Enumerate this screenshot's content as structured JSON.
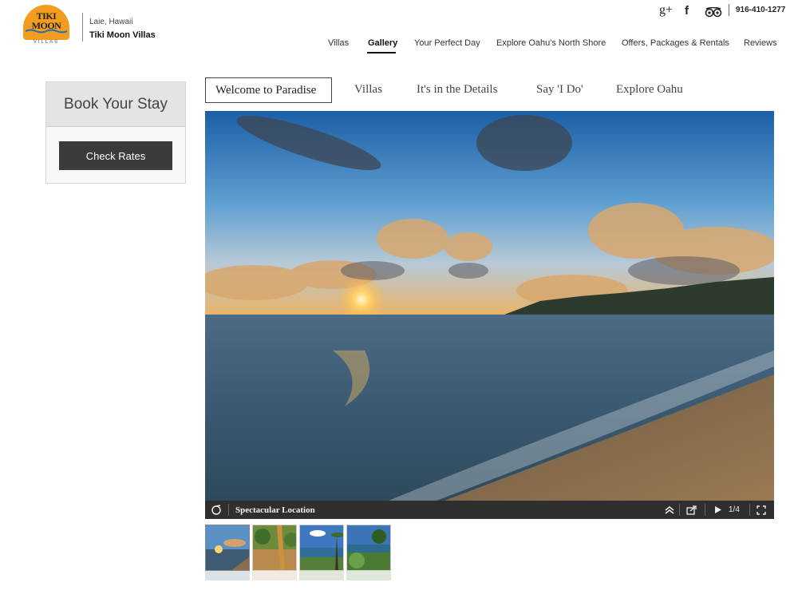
{
  "brand": {
    "logo_line1": "TIKI",
    "logo_line2": "MOON",
    "logo_sub": "VILLAS",
    "location": "Laie, Hawaii",
    "name": "Tiki Moon Villas"
  },
  "header": {
    "social": {
      "gplus_glyph": "g+",
      "facebook_glyph": "f"
    },
    "phone": "916-410-1277"
  },
  "nav": {
    "items": [
      {
        "label": "Villas"
      },
      {
        "label": "Gallery"
      },
      {
        "label": "Your Perfect Day"
      },
      {
        "label": "Explore Oahu's North Shore"
      },
      {
        "label": "Offers, Packages & Rentals"
      },
      {
        "label": "Reviews"
      }
    ],
    "active": "Gallery"
  },
  "booking": {
    "title": "Book Your Stay",
    "button_label": "Check Rates"
  },
  "gallery": {
    "tabs": [
      {
        "label": "Welcome to Paradise"
      },
      {
        "label": "Villas"
      },
      {
        "label": "It's in the Details"
      },
      {
        "label": "Say 'I Do'"
      },
      {
        "label": "Explore Oahu"
      }
    ],
    "active_tab": "Welcome to Paradise",
    "caption": "Spectacular Location",
    "counter": "1/4",
    "thumbnail_count": 4
  },
  "colors": {
    "logo_sun": "#f39c1f",
    "button_dark": "#3b3b3b",
    "toolbar_bg": "#2f2f2f"
  }
}
